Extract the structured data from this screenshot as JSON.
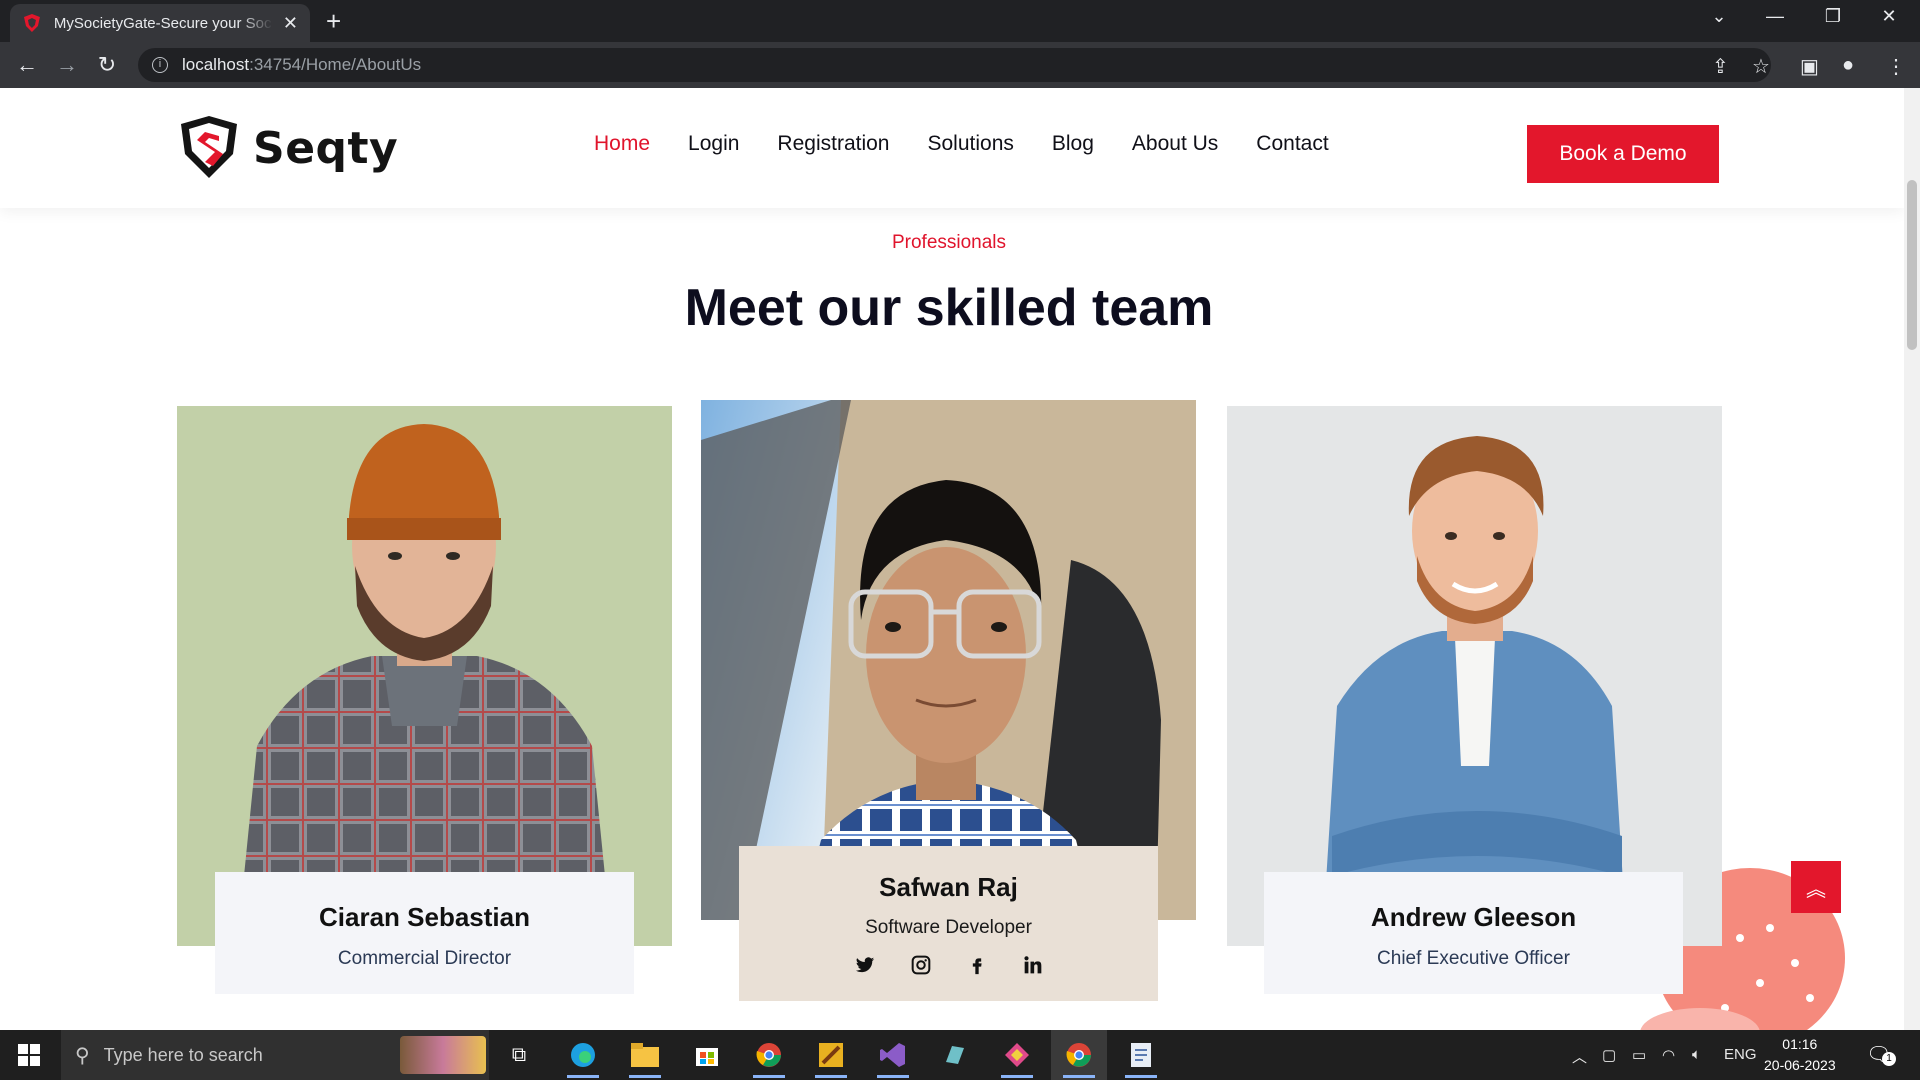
{
  "browser": {
    "tab_title": "MySocietyGate-Secure your Society",
    "url_host": "localhost",
    "url_path": ":34754/Home/AboutUs"
  },
  "site": {
    "brand": "Seqty",
    "nav": [
      "Home",
      "Login",
      "Registration",
      "Solutions",
      "Blog",
      "About Us",
      "Contact"
    ],
    "active_nav": "Home",
    "cta": "Book a Demo"
  },
  "team": {
    "eyebrow": "Professionals",
    "title": "Meet our skilled team",
    "members": [
      {
        "name": "Ciaran Sebastian",
        "role": "Commercial Director"
      },
      {
        "name": "Safwan Raj",
        "role": "Software Developer"
      },
      {
        "name": "Andrew Gleeson",
        "role": "Chief Executive Officer"
      }
    ]
  },
  "taskbar": {
    "search_placeholder": "Type here to search",
    "language": "ENG",
    "time": "01:16",
    "date": "20-06-2023",
    "notification_count": "1"
  },
  "colors": {
    "accent": "#e3172c",
    "heading": "#0d0d1e",
    "card_bg": "#f4f5f9",
    "featured_card_bg": "#e9e0d6"
  }
}
